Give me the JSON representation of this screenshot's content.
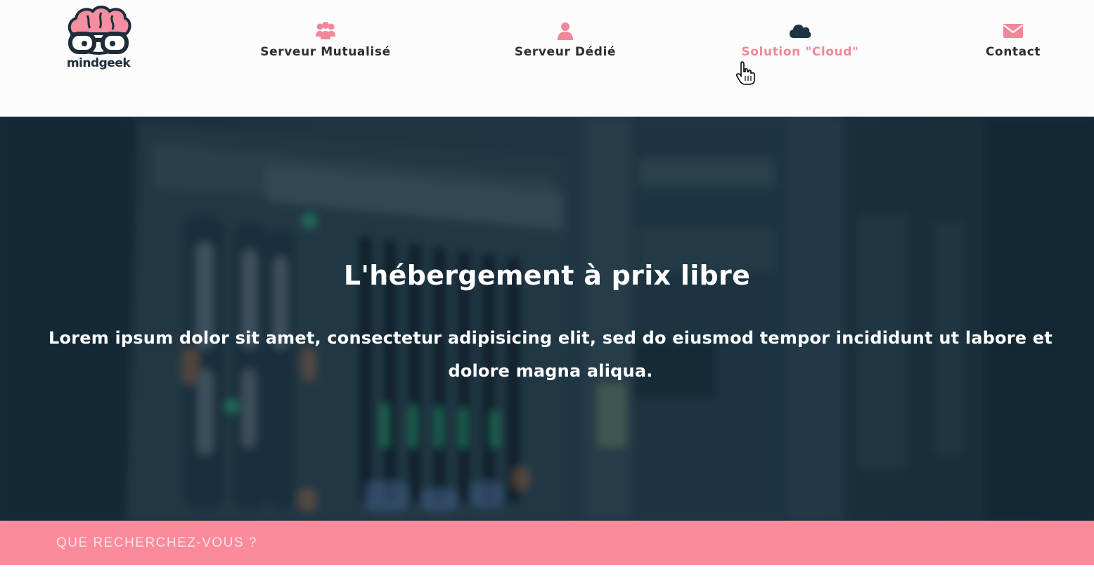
{
  "logo": {
    "text": "mindgeek"
  },
  "nav": {
    "items": [
      {
        "label": "Serveur Mutualisé",
        "icon": "users-icon"
      },
      {
        "label": "Serveur Dédié",
        "icon": "user-icon"
      },
      {
        "label": "Solution \"Cloud\"",
        "icon": "cloud-icon",
        "active": true
      },
      {
        "label": "Contact",
        "icon": "envelope-icon"
      }
    ]
  },
  "hero": {
    "title": "L'hébergement à prix libre",
    "text": "Lorem ipsum dolor sit amet, consectetur adipisicing elit, sed do eiusmod tempor incididunt ut labore et dolore magna aliqua."
  },
  "search": {
    "placeholder": "QUE RECHERCHEZ-VOUS ?",
    "value": ""
  },
  "colors": {
    "accent": "#f2879a",
    "search_bar": "#fb8b9b",
    "nav_text": "#2b2f33",
    "cloud_icon": "#1f3443"
  }
}
